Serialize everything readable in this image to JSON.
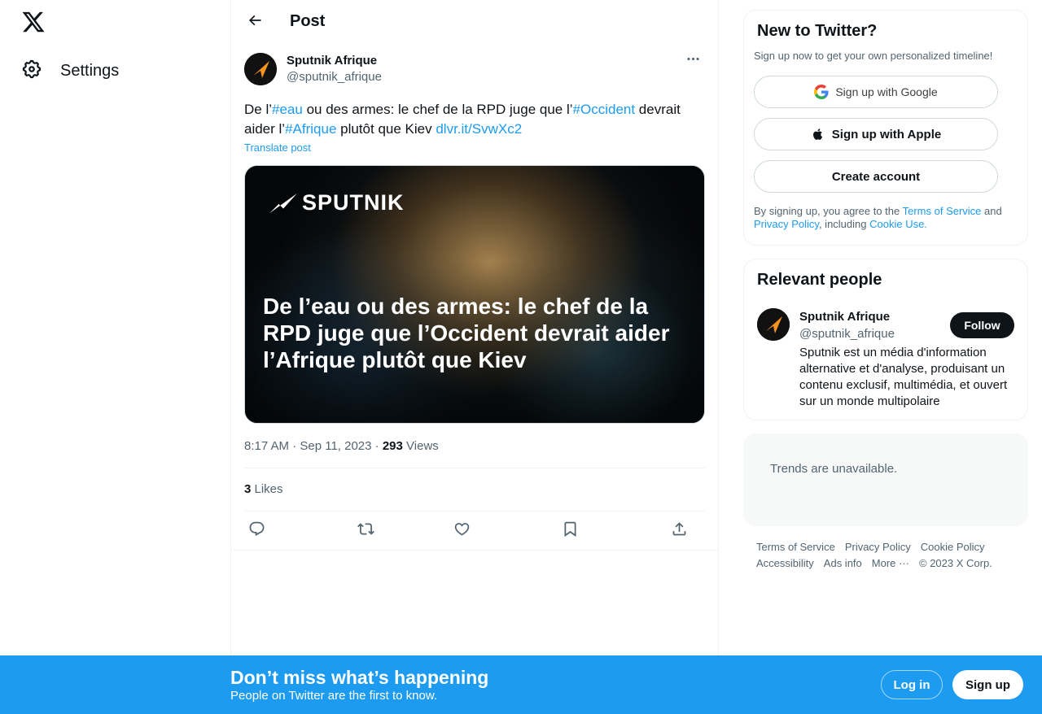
{
  "nav": {
    "logo_icon": "x-logo-icon",
    "settings_label": "Settings"
  },
  "header": {
    "title": "Post"
  },
  "tweet": {
    "author_name": "Sputnik Afrique",
    "author_handle": "@sputnik_afrique",
    "text": {
      "t1": "De l’",
      "h1": "#eau",
      "t2": " ou des armes: le chef de la RPD juge que l’",
      "h2": "#Occident",
      "t3": " devrait aider l’",
      "h3": "#Afrique",
      "t4": " plutôt que Kiev ",
      "link": "dlvr.it/SvwXc2"
    },
    "translate_label": "Translate post",
    "media": {
      "logo_text": "SPUTNIK",
      "headline": "De l’eau ou des armes: le chef de la RPD juge que l’Occident devrait aider l’Afrique plutôt que Kiev"
    },
    "timestamp": "8:17 AM · Sep 11, 2023",
    "separator": " · ",
    "views_count": "293",
    "views_label": " Views",
    "likes_count": "3",
    "likes_label": " Likes"
  },
  "signup_card": {
    "title": "New to Twitter?",
    "subtitle": "Sign up now to get your own personalized timeline!",
    "google_label": "Sign up with Google",
    "apple_label": "Sign up with Apple",
    "create_label": "Create account",
    "legal": {
      "t1": "By signing up, you agree to the ",
      "tos": "Terms of Service",
      "t2": " and ",
      "privacy": "Privacy Policy",
      "t3": ", including ",
      "cookie": "Cookie Use."
    }
  },
  "people_card": {
    "title": "Relevant people",
    "name": "Sputnik Afrique",
    "handle": "@sputnik_afrique",
    "follow_label": "Follow",
    "bio": "Sputnik est un média d'information alternative et d'analyse, produisant un contenu exclusif, multimédia, et ouvert sur un monde multipolaire"
  },
  "trends": {
    "text": "Trends are unavailable."
  },
  "footer": {
    "terms": "Terms of Service",
    "privacy": "Privacy Policy",
    "cookie": "Cookie Policy",
    "accessibility": "Accessibility",
    "ads": "Ads info",
    "more": "More ···",
    "copyright": "© 2023 X Corp."
  },
  "bottom_bar": {
    "title": "Don’t miss what’s happening",
    "subtitle": "People on Twitter are the first to know.",
    "login_label": "Log in",
    "signup_label": "Sign up"
  },
  "colors": {
    "accent": "#1d9bf0",
    "text": "#0f1419",
    "muted": "#536471",
    "sputnik_orange": "#f7941d"
  }
}
